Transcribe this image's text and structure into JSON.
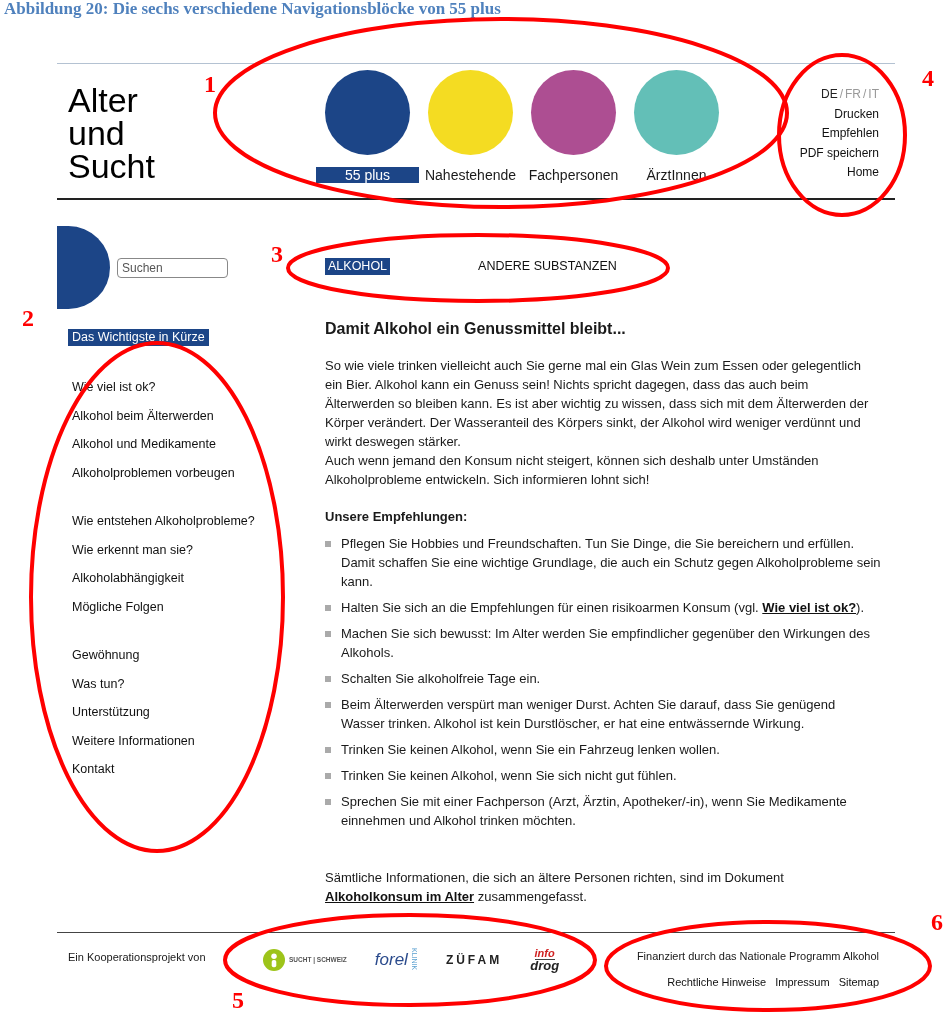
{
  "caption": "Abbildung 20: Die sechs verschiedene Navigationsblöcke von 55 plus",
  "logo": [
    "Alter",
    "und",
    "Sucht"
  ],
  "audiences": [
    {
      "label": "55 plus",
      "color": "#1c4587",
      "selected": true
    },
    {
      "label": "Nahestehende",
      "color": "#f4dc22",
      "selected": false
    },
    {
      "label": "Fachpersonen",
      "color": "#ad4e92",
      "selected": false
    },
    {
      "label": "ÄrztInnen",
      "color": "#63bfb7",
      "selected": false
    }
  ],
  "languages": [
    {
      "label": "DE",
      "selected": true
    },
    {
      "label": "FR",
      "selected": false
    },
    {
      "label": "IT",
      "selected": false
    }
  ],
  "language_separator": "/",
  "utility_links": [
    "Drucken",
    "Empfehlen",
    "PDF speichern",
    "Home"
  ],
  "search": {
    "placeholder": "Suchen"
  },
  "sidebar": {
    "groups": [
      {
        "items": [
          {
            "label": "Das Wichtigste in Kürze",
            "selected": true
          }
        ]
      },
      {
        "items": [
          {
            "label": "Wie viel ist ok?",
            "selected": false
          },
          {
            "label": "Alkohol beim Älterwerden",
            "selected": false
          },
          {
            "label": "Alkohol und Medikamente",
            "selected": false
          },
          {
            "label": "Alkoholproblemen vorbeugen",
            "selected": false
          }
        ]
      },
      {
        "items": [
          {
            "label": "Wie entstehen Alkoholprobleme?",
            "selected": false
          },
          {
            "label": "Wie erkennt man sie?",
            "selected": false
          },
          {
            "label": "Alkoholabhängigkeit",
            "selected": false
          },
          {
            "label": "Mögliche Folgen",
            "selected": false
          }
        ]
      },
      {
        "items": [
          {
            "label": "Gewöhnung",
            "selected": false
          },
          {
            "label": "Was tun?",
            "selected": false
          },
          {
            "label": "Unterstützung",
            "selected": false
          },
          {
            "label": "Weitere Informationen",
            "selected": false
          },
          {
            "label": "Kontakt",
            "selected": false
          }
        ]
      }
    ]
  },
  "tabs": [
    {
      "label": "ALKOHOL",
      "selected": true
    },
    {
      "label": "ANDERE SUBSTANZEN",
      "selected": false
    }
  ],
  "heading": "Damit Alkohol ein Genussmittel bleibt...",
  "paragraphs": [
    "So wie viele trinken vielleicht auch Sie gerne mal ein Glas Wein zum Essen oder gelegentlich ein Bier. Alkohol kann ein Genuss sein! Nichts spricht dagegen, dass das auch beim Älterwerden so bleiben kann. Es ist aber wichtig zu wissen, dass sich mit dem Älterwerden der Körper verändert. Der Wasseranteil des Körpers sinkt, der Alkohol wird weniger verdünnt und wirkt deswegen stärker.",
    "Auch wenn jemand den Konsum nicht steigert, können sich deshalb unter Umständen Alkoholprobleme entwickeln. Sich informieren lohnt sich!"
  ],
  "subheading": "Unsere Empfehlungen:",
  "recommendations": [
    {
      "text": "Pflegen Sie Hobbies und Freundschaften. Tun Sie Dinge, die Sie bereichern und erfüllen. Damit schaffen Sie eine wichtige Grundlage, die auch ein Schutz gegen Alkoholprobleme sein kann."
    },
    {
      "text": "Halten Sie sich an die Empfehlungen für einen risikoarmen Konsum (vgl. ",
      "link": "Wie viel ist ok?",
      "after": ")."
    },
    {
      "text": "Machen Sie sich bewusst: Im Alter werden Sie empfindlicher gegenüber den Wirkungen des Alkohols."
    },
    {
      "text": "Schalten Sie alkoholfreie Tage ein."
    },
    {
      "text": "Beim Älterwerden verspürt man weniger Durst. Achten Sie darauf, dass Sie genügend Wasser trinken. Alkohol ist kein Durstlöscher, er hat eine entwässernde Wirkung."
    },
    {
      "text": "Trinken Sie keinen Alkohol, wenn Sie ein Fahrzeug lenken wollen."
    },
    {
      "text": "Trinken Sie keinen Alkohol, wenn Sie sich nicht gut fühlen."
    },
    {
      "text": "Sprechen Sie mit einer Fachperson (Arzt, Ärztin, Apotheker/-in), wenn Sie Medikamente einnehmen und Alkohol trinken möchten."
    }
  ],
  "closing": {
    "text": "Sämtliche Informationen, die sich an ältere Personen richten, sind im Dokument ",
    "link": "Alkoholkonsum im Alter",
    "after": " zusammengefasst."
  },
  "footer": {
    "cooperation": "Ein Kooperationsprojekt von",
    "partners": [
      {
        "kind": "sucht_schweiz",
        "texts": [
          "SUCHT",
          "|",
          "SCHWEIZ"
        ]
      },
      {
        "kind": "forel",
        "texts": [
          "forel",
          "KLINIK"
        ]
      },
      {
        "kind": "zufam",
        "texts": [
          "ZÜFAM"
        ]
      },
      {
        "kind": "infodrog",
        "texts": [
          "info",
          "drog"
        ]
      }
    ],
    "funding": "Finanziert durch das Nationale Programm Alkohol",
    "links": [
      "Rechtliche Hinweise",
      "Impressum",
      "Sitemap"
    ]
  },
  "annotations": [
    {
      "label": "1"
    },
    {
      "label": "2"
    },
    {
      "label": "3"
    },
    {
      "label": "4"
    },
    {
      "label": "5"
    },
    {
      "label": "6"
    }
  ]
}
